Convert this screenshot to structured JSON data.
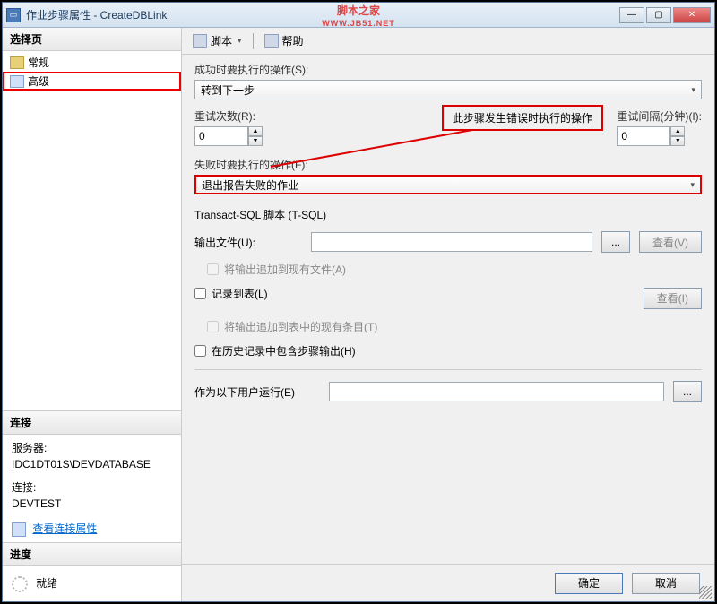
{
  "window": {
    "title": "作业步骤属性 - CreateDBLink"
  },
  "watermark": {
    "main": "脚本之家",
    "sub": "WWW.JB51.NET"
  },
  "sidebar": {
    "select_hdr": "选择页",
    "items": [
      {
        "label": "常规"
      },
      {
        "label": "高级"
      }
    ],
    "connection_hdr": "连接",
    "server_lbl": "服务器:",
    "server_val": "IDC1DT01S\\DEVDATABASE",
    "conn_lbl": "连接:",
    "conn_val": "DEVTEST",
    "view_conn": "查看连接属性",
    "progress_hdr": "进度",
    "progress_val": "就绪"
  },
  "toolbar": {
    "script": "脚本",
    "help": "帮助"
  },
  "form": {
    "success_lbl": "成功时要执行的操作(S):",
    "success_val": "转到下一步",
    "retry_lbl": "重试次数(R):",
    "retry_val": "0",
    "interval_lbl": "重试间隔(分钟)(I):",
    "interval_val": "0",
    "callout": "此步骤发生错误时执行的操作",
    "fail_lbl": "失败时要执行的操作(F):",
    "fail_val": "退出报告失败的作业",
    "tsql_hdr": "Transact-SQL 脚本 (T-SQL)",
    "output_lbl": "输出文件(U):",
    "output_val": "",
    "browse": "...",
    "view_btn": "查看(V)",
    "append_file": "将输出追加到现有文件(A)",
    "log_table": "记录到表(L)",
    "view_btn2": "查看(I)",
    "append_table": "将输出追加到表中的现有条目(T)",
    "history": "在历史记录中包含步骤输出(H)",
    "run_as_lbl": "作为以下用户运行(E)",
    "run_as_val": ""
  },
  "footer": {
    "ok": "确定",
    "cancel": "取消"
  }
}
